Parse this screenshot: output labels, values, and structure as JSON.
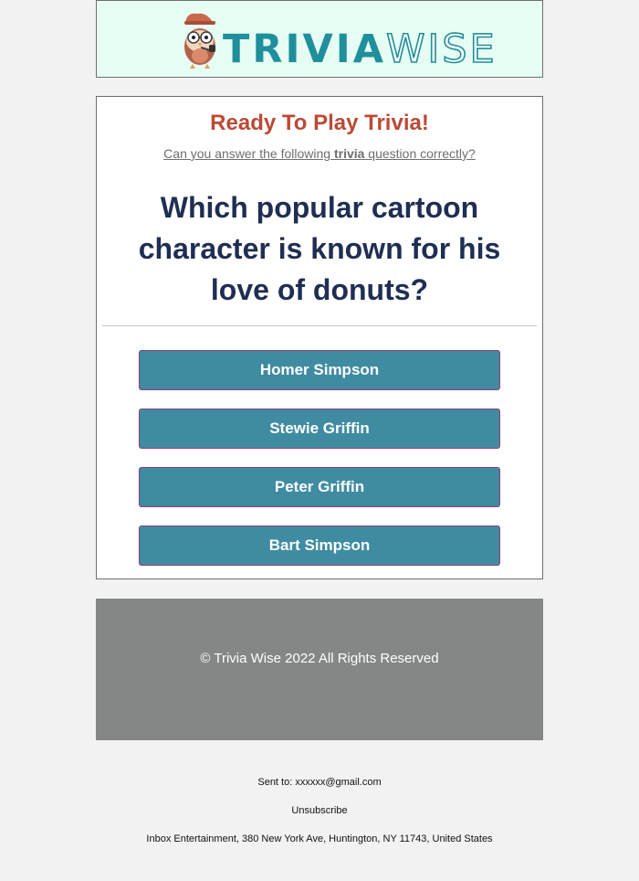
{
  "header": {
    "brand": {
      "part1": "TRIVIA",
      "part2": "WISE"
    }
  },
  "card": {
    "title": "Ready To Play Trivia!",
    "subtitle_before": "Can you answer the following ",
    "subtitle_bold": "trivia",
    "subtitle_after": " question correctly?",
    "question": "Which popular cartoon character is known for his love of donuts?",
    "answers": [
      "Homer Simpson",
      "Stewie Griffin",
      "Peter Griffin",
      "Bart Simpson"
    ]
  },
  "footer": {
    "copyright": "© Trivia Wise 2022 All Rights Reserved"
  },
  "meta": {
    "sent_to": "Sent to: xxxxxx@gmail.com",
    "unsubscribe": "Unsubscribe",
    "address": "Inbox Entertainment, 380 New York Ave, Huntington, NY 11743, United States"
  },
  "colors": {
    "header_bg": "#e6fdf3",
    "brand_teal": "#1f8f9b",
    "title_red": "#bb4a35",
    "question_navy": "#1f2e52",
    "button_teal": "#3f8ca2",
    "footer_gray": "#858686"
  },
  "icons": {
    "logo_mascot": "owl-with-pipe-icon"
  }
}
